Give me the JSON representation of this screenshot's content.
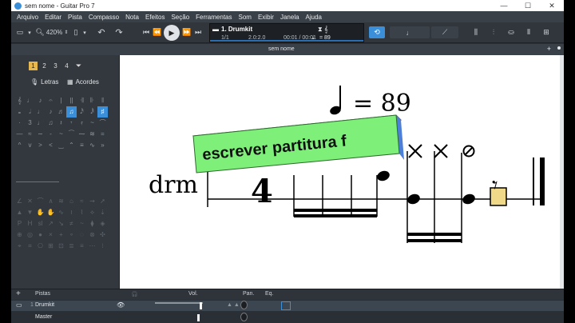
{
  "window": {
    "title": "sem nome - Guitar Pro 7",
    "controls": [
      "—",
      "☐",
      "✕"
    ]
  },
  "menu": [
    "Arquivo",
    "Editar",
    "Pista",
    "Compasso",
    "Nota",
    "Efeitos",
    "Seção",
    "Ferramentas",
    "Som",
    "Exibir",
    "Janela",
    "Ajuda"
  ],
  "toolbar": {
    "zoom": "420%",
    "lcd": {
      "track": "1. Drumkit",
      "position": "1/1",
      "signature": "2.0:2.0",
      "time": "00:01 / 00:01",
      "tempo_label": "= 89",
      "tempo_icon": "𝅘𝅥"
    }
  },
  "document_tab": {
    "title": "sem nome",
    "plus": "+"
  },
  "left_panel": {
    "voice_tabs": [
      "1",
      "2",
      "3",
      "4"
    ],
    "lyrics_button": "Letras",
    "chords_button": "Acordes",
    "rows": [
      [
        "𝄞",
        "♩",
        "♪",
        "𝄐",
        "|",
        "||",
        "𝄇",
        "𝄆",
        "𝄂"
      ],
      [
        "𝅝",
        "𝅗𝅥",
        "♩",
        "♪",
        "♬",
        "♫",
        "𝅘𝅥𝅰",
        "𝅘𝅥𝅱",
        "♯"
      ],
      [
        "·",
        "3",
        "♩",
        "♫",
        "𝄽",
        "𝄾",
        "𝄿",
        "~",
        "⌒"
      ],
      [
        "—",
        "≈",
        "∼",
        "-",
        "~",
        "⁀",
        "⁓",
        "≋",
        "="
      ],
      [
        "^",
        "v",
        ">",
        "<",
        "‿",
        "⌃",
        "≡",
        "∿",
        "»"
      ]
    ],
    "dim_rows": [
      [
        "∠",
        "✕",
        "⌒",
        "∧",
        "≋",
        "⌂",
        "≈",
        "⇝",
        "➚"
      ],
      [
        "▲",
        "▼",
        "✋",
        "✋",
        "∿",
        "≀",
        "⌇",
        "⟡",
        "⇣"
      ],
      [
        "P",
        "H",
        "sl",
        "↗",
        "↘",
        "≠",
        "~",
        "⧫",
        "◈"
      ],
      [
        "⊕",
        "◎",
        "●",
        "×",
        "+",
        "∘",
        "◌",
        "⊗",
        "✣"
      ],
      [
        "⌖",
        "⌗",
        "⎔",
        "⊞",
        "⊡",
        "≣",
        "≡",
        "⋯",
        "⁝"
      ]
    ]
  },
  "score": {
    "tempo_equals": "= 89",
    "track_name": "drm",
    "time_signature": "4",
    "overlay_text": "escrever partitura f"
  },
  "tracks_panel": {
    "header": {
      "add": "+",
      "tracks_label": "Pistas",
      "volume_label": "Vol.",
      "pan_label": "Pan.",
      "eq_label": "Eq."
    },
    "rows": [
      {
        "name": "Drumkit",
        "index": "1"
      },
      {
        "name": "Master"
      }
    ]
  },
  "colors": {
    "accent": "#3a8fd8",
    "active_tab": "#e8b84c",
    "overlay_face": "#7ef07a",
    "overlay_top": "#e9e370",
    "overlay_side": "#4e7fd8"
  }
}
